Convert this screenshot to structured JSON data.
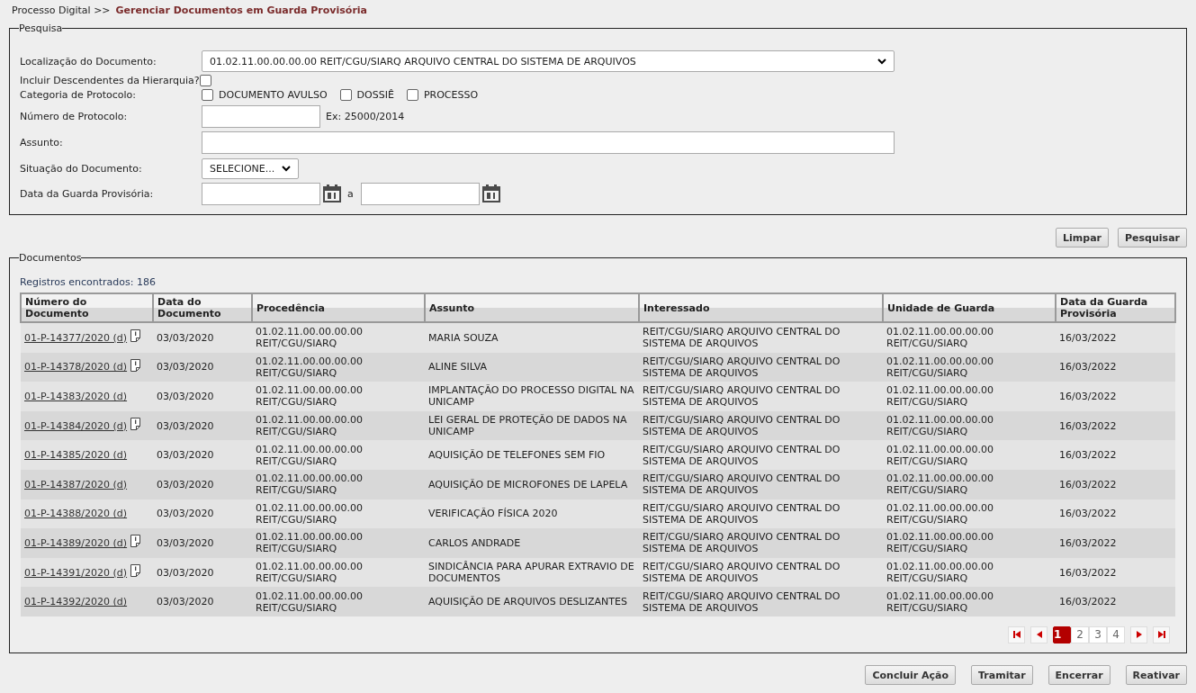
{
  "breadcrumb": {
    "parent": "Processo Digital >>",
    "current": "Gerenciar Documentos em Guarda Provisória"
  },
  "search": {
    "legend": "Pesquisa",
    "location": {
      "label": "Localização do Documento:",
      "value": "01.02.11.00.00.00.00 REIT/CGU/SIARQ ARQUIVO CENTRAL DO SISTEMA DE ARQUIVOS"
    },
    "include_descendants": {
      "label": "Incluir Descendentes da Hierarquia?",
      "checked": false
    },
    "category": {
      "label": "Categoria de Protocolo:",
      "options": [
        {
          "label": "DOCUMENTO AVULSO",
          "checked": false
        },
        {
          "label": "DOSSIÊ",
          "checked": false
        },
        {
          "label": "PROCESSO",
          "checked": false
        }
      ]
    },
    "protocol": {
      "label": "Número de Protocolo:",
      "hint": "Ex: 25000/2014"
    },
    "subject": {
      "label": "Assunto:"
    },
    "status": {
      "label": "Situação do Documento:",
      "value": "SELECIONE..."
    },
    "date": {
      "label": "Data da Guarda Provisória:",
      "separator": "a"
    },
    "buttons": [
      "Limpar",
      "Pesquisar"
    ]
  },
  "documents": {
    "legend": "Documentos",
    "count": "Registros encontrados: 186",
    "columns": [
      "Número do Documento",
      "Data do Documento",
      "Procedência",
      "Assunto",
      "Interessado",
      "Unidade de Guarda",
      "Data da Guarda Provisória"
    ],
    "rows": [
      {
        "number": "01-P-14377/2020 (d)",
        "note": true,
        "date": "03/03/2020",
        "origin": "01.02.11.00.00.00.00 REIT/CGU/SIARQ",
        "subject": "MARIA SOUZA",
        "interested": "REIT/CGU/SIARQ ARQUIVO CENTRAL DO SISTEMA DE ARQUIVOS",
        "unit": "01.02.11.00.00.00.00 REIT/CGU/SIARQ",
        "guard_date": "16/03/2022"
      },
      {
        "number": "01-P-14378/2020 (d)",
        "note": true,
        "date": "03/03/2020",
        "origin": "01.02.11.00.00.00.00 REIT/CGU/SIARQ",
        "subject": "ALINE SILVA",
        "interested": "REIT/CGU/SIARQ ARQUIVO CENTRAL DO SISTEMA DE ARQUIVOS",
        "unit": "01.02.11.00.00.00.00 REIT/CGU/SIARQ",
        "guard_date": "16/03/2022"
      },
      {
        "number": "01-P-14383/2020 (d)",
        "note": false,
        "date": "03/03/2020",
        "origin": "01.02.11.00.00.00.00 REIT/CGU/SIARQ",
        "subject": "IMPLANTAÇÃO DO PROCESSO DIGITAL NA UNICAMP",
        "interested": "REIT/CGU/SIARQ ARQUIVO CENTRAL DO SISTEMA DE ARQUIVOS",
        "unit": "01.02.11.00.00.00.00 REIT/CGU/SIARQ",
        "guard_date": "16/03/2022"
      },
      {
        "number": "01-P-14384/2020 (d)",
        "note": true,
        "date": "03/03/2020",
        "origin": "01.02.11.00.00.00.00 REIT/CGU/SIARQ",
        "subject": "LEI GERAL DE PROTEÇÃO DE DADOS NA UNICAMP",
        "interested": "REIT/CGU/SIARQ ARQUIVO CENTRAL DO SISTEMA DE ARQUIVOS",
        "unit": "01.02.11.00.00.00.00 REIT/CGU/SIARQ",
        "guard_date": "16/03/2022"
      },
      {
        "number": "01-P-14385/2020 (d)",
        "note": false,
        "date": "03/03/2020",
        "origin": "01.02.11.00.00.00.00 REIT/CGU/SIARQ",
        "subject": "AQUISIÇÃO DE TELEFONES SEM FIO",
        "interested": "REIT/CGU/SIARQ ARQUIVO CENTRAL DO SISTEMA DE ARQUIVOS",
        "unit": "01.02.11.00.00.00.00 REIT/CGU/SIARQ",
        "guard_date": "16/03/2022"
      },
      {
        "number": "01-P-14387/2020 (d)",
        "note": false,
        "date": "03/03/2020",
        "origin": "01.02.11.00.00.00.00 REIT/CGU/SIARQ",
        "subject": "AQUISIÇÃO DE MICROFONES DE LAPELA",
        "interested": "REIT/CGU/SIARQ ARQUIVO CENTRAL DO SISTEMA DE ARQUIVOS",
        "unit": "01.02.11.00.00.00.00 REIT/CGU/SIARQ",
        "guard_date": "16/03/2022"
      },
      {
        "number": "01-P-14388/2020 (d)",
        "note": false,
        "date": "03/03/2020",
        "origin": "01.02.11.00.00.00.00 REIT/CGU/SIARQ",
        "subject": "VERIFICAÇÃO FÍSICA 2020",
        "interested": "REIT/CGU/SIARQ ARQUIVO CENTRAL DO SISTEMA DE ARQUIVOS",
        "unit": "01.02.11.00.00.00.00 REIT/CGU/SIARQ",
        "guard_date": "16/03/2022"
      },
      {
        "number": "01-P-14389/2020 (d)",
        "note": true,
        "date": "03/03/2020",
        "origin": "01.02.11.00.00.00.00 REIT/CGU/SIARQ",
        "subject": "CARLOS ANDRADE",
        "interested": "REIT/CGU/SIARQ ARQUIVO CENTRAL DO SISTEMA DE ARQUIVOS",
        "unit": "01.02.11.00.00.00.00 REIT/CGU/SIARQ",
        "guard_date": "16/03/2022"
      },
      {
        "number": "01-P-14391/2020 (d)",
        "note": true,
        "date": "03/03/2020",
        "origin": "01.02.11.00.00.00.00 REIT/CGU/SIARQ",
        "subject": "SINDICÂNCIA PARA APURAR EXTRAVIO DE DOCUMENTOS",
        "interested": "REIT/CGU/SIARQ ARQUIVO CENTRAL DO SISTEMA DE ARQUIVOS",
        "unit": "01.02.11.00.00.00.00 REIT/CGU/SIARQ",
        "guard_date": "16/03/2022"
      },
      {
        "number": "01-P-14392/2020 (d)",
        "note": false,
        "date": "03/03/2020",
        "origin": "01.02.11.00.00.00.00 REIT/CGU/SIARQ",
        "subject": "AQUISIÇÃO DE ARQUIVOS DESLIZANTES",
        "interested": "REIT/CGU/SIARQ ARQUIVO CENTRAL DO SISTEMA DE ARQUIVOS",
        "unit": "01.02.11.00.00.00.00 REIT/CGU/SIARQ",
        "guard_date": "16/03/2022"
      }
    ],
    "pages": [
      {
        "label": "1",
        "selected": true
      },
      {
        "label": "2",
        "selected": false
      },
      {
        "label": "3",
        "selected": false
      },
      {
        "label": "4",
        "selected": false
      }
    ]
  },
  "actions": [
    "Concluir Ação",
    "Tramitar",
    "Encerrar",
    "Reativar"
  ]
}
